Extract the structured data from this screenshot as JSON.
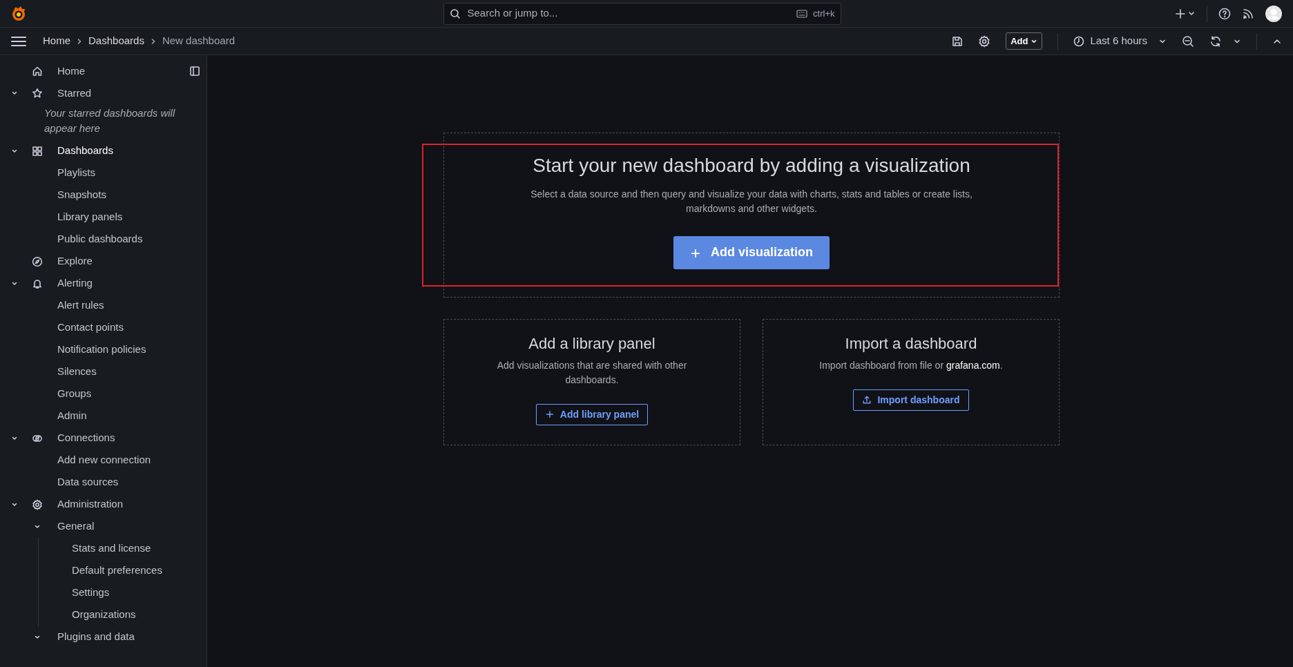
{
  "top_bar": {
    "search": {
      "placeholder": "Search or jump to...",
      "shortcut": "ctrl+k"
    }
  },
  "breadcrumbs": [
    {
      "label": "Home",
      "current": false
    },
    {
      "label": "Dashboards",
      "current": false
    },
    {
      "label": "New dashboard",
      "current": true
    }
  ],
  "toolbar": {
    "add_button": "Add",
    "time_range": "Last 6 hours"
  },
  "sidebar": {
    "items": [
      {
        "label": "Home",
        "selected": false
      },
      {
        "label": "Starred",
        "selected": false,
        "expanded": true,
        "note": "Your starred dashboards will appear here"
      },
      {
        "label": "Dashboards",
        "selected": true,
        "expanded": true,
        "children": [
          {
            "label": "Playlists",
            "selected": false
          },
          {
            "label": "Snapshots",
            "selected": false
          },
          {
            "label": "Library panels",
            "selected": false
          },
          {
            "label": "Public dashboards",
            "selected": false
          }
        ]
      },
      {
        "label": "Explore",
        "selected": false
      },
      {
        "label": "Alerting",
        "selected": false,
        "expanded": true,
        "children": [
          {
            "label": "Alert rules",
            "selected": false
          },
          {
            "label": "Contact points",
            "selected": false
          },
          {
            "label": "Notification policies",
            "selected": false
          },
          {
            "label": "Silences",
            "selected": false
          },
          {
            "label": "Groups",
            "selected": false
          },
          {
            "label": "Admin",
            "selected": false
          }
        ]
      },
      {
        "label": "Connections",
        "selected": false,
        "expanded": true,
        "children": [
          {
            "label": "Add new connection",
            "selected": false
          },
          {
            "label": "Data sources",
            "selected": false
          }
        ]
      },
      {
        "label": "Administration",
        "selected": false,
        "expanded": true,
        "children": [
          {
            "label": "General",
            "selected": false,
            "expanded": true,
            "children": [
              {
                "label": "Stats and license",
                "selected": false
              },
              {
                "label": "Default preferences",
                "selected": false
              },
              {
                "label": "Settings",
                "selected": false
              },
              {
                "label": "Organizations",
                "selected": false
              }
            ]
          },
          {
            "label": "Plugins and data",
            "selected": false,
            "expanded": true
          }
        ]
      }
    ]
  },
  "empty_state": {
    "title": "Start your new dashboard by adding a visualization",
    "description": "Select a data source and then query and visualize your data with charts, stats and tables or create lists, markdowns and other widgets.",
    "button": "Add visualization"
  },
  "cards": [
    {
      "title": "Add a library panel",
      "description": "Add visualizations that are shared with other dashboards.",
      "button": "Add library panel"
    },
    {
      "title": "Import a dashboard",
      "description": "Import dashboard from file or ",
      "link": "grafana.com",
      "tail": ".",
      "button": "Import dashboard"
    }
  ]
}
